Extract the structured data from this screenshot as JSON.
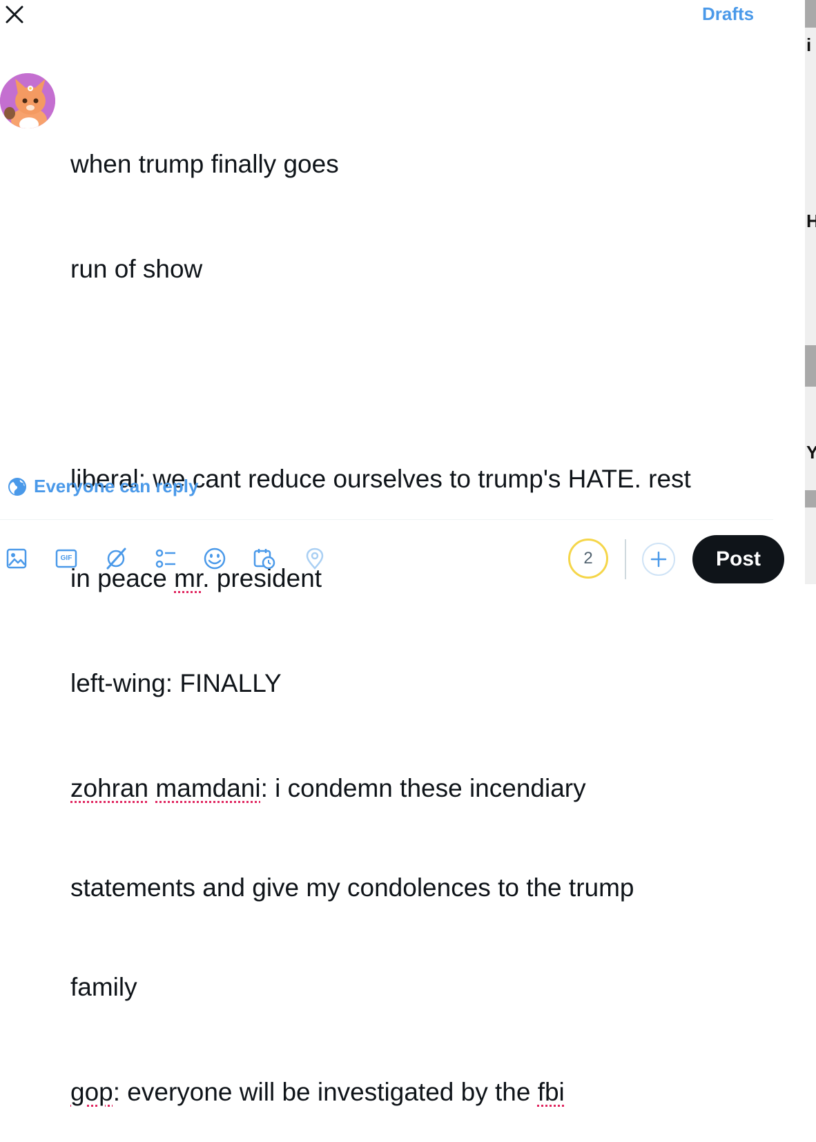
{
  "header": {
    "drafts_label": "Drafts"
  },
  "composer": {
    "lines": [
      "when trump finally goes",
      "run of show",
      "liberal: we cant reduce ourselves to trump's HATE. rest",
      "in peace ",
      "mr",
      ". president",
      "left-wing: FINALLY",
      "zohran",
      " ",
      "mamdani",
      ": i condemn these incendiary",
      "statements and give my condolences to the trump",
      "family",
      "gop",
      ": everyone will be investigated by the ",
      "fbi"
    ]
  },
  "reply_setting": {
    "label": "Everyone can reply"
  },
  "toolbar": {
    "icons": [
      "image-icon",
      "gif-icon",
      "grok-icon",
      "poll-icon",
      "emoji-icon",
      "schedule-icon",
      "location-icon"
    ],
    "gif_text": "GIF",
    "counter_value": "2",
    "post_label": "Post"
  },
  "colors": {
    "accent": "#4a99e9",
    "post_button_bg": "#0f1419",
    "counter_ring": "#f5d64a",
    "spellcheck": "#e0245e"
  }
}
